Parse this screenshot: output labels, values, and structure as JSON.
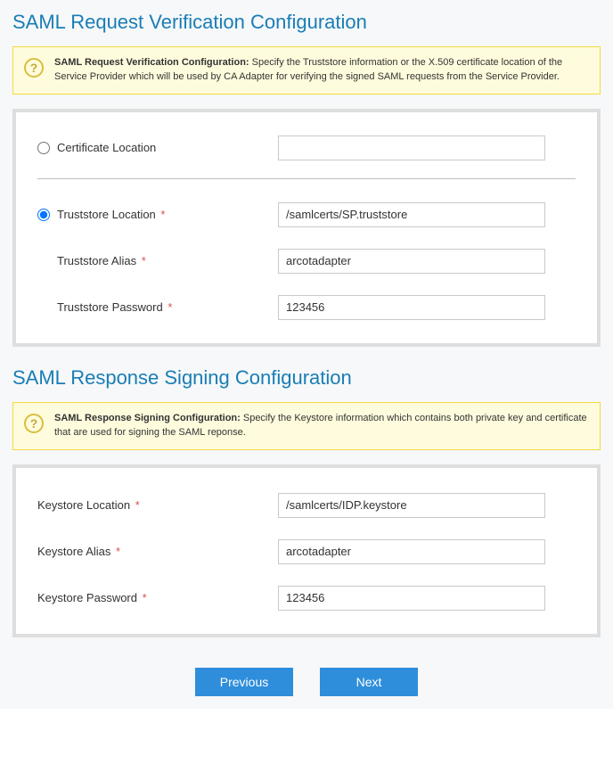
{
  "request": {
    "title": "SAML Request Verification Configuration",
    "infoTitle": "SAML Request Verification Configuration:",
    "infoText": "Specify the Truststore information or the X.509 certificate location of the Service Provider which will be used by CA Adapter for verifying the signed SAML requests from the Service Provider.",
    "certOption": "Certificate Location",
    "certValue": "",
    "selectedOption": "truststore",
    "trustOption": "Truststore Location",
    "trustValue": "/samlcerts/SP.truststore",
    "aliasLabel": "Truststore Alias",
    "aliasValue": "arcotadapter",
    "passwordLabel": "Truststore Password",
    "passwordValue": "123456"
  },
  "response": {
    "title": "SAML Response Signing Configuration",
    "infoTitle": "SAML Response Signing Configuration:",
    "infoText": "Specify the Keystore information which contains both private key and certificate that are used for signing the SAML reponse.",
    "locLabel": "Keystore Location",
    "locValue": "/samlcerts/IDP.keystore",
    "aliasLabel": "Keystore Alias",
    "aliasValue": "arcotadapter",
    "passwordLabel": "Keystore Password",
    "passwordValue": "123456"
  },
  "buttons": {
    "prev": "Previous",
    "next": "Next"
  }
}
